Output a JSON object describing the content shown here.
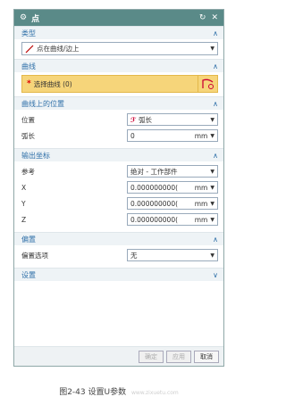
{
  "dialog": {
    "title": "点",
    "reset_icon": "reset-icon",
    "close_icon": "close-icon"
  },
  "type_section": {
    "header": "类型",
    "value": "点在曲线/边上"
  },
  "curve_section": {
    "header": "曲线",
    "select_label": "选择曲线 (0)"
  },
  "position_section": {
    "header": "曲线上的位置",
    "position_label": "位置",
    "position_value": "弧长",
    "arc_label": "弧长",
    "arc_value": "0",
    "arc_unit": "mm"
  },
  "output_section": {
    "header": "输出坐标",
    "ref_label": "参考",
    "ref_value": "绝对 - 工作部件",
    "x_label": "X",
    "x_value": "0.000000000(",
    "x_unit": "mm",
    "y_label": "Y",
    "y_value": "0.000000000(",
    "y_unit": "mm",
    "z_label": "Z",
    "z_value": "0.000000000(",
    "z_unit": "mm"
  },
  "offset_section": {
    "header": "偏置",
    "option_label": "偏置选项",
    "option_value": "无"
  },
  "settings_section": {
    "header": "设置"
  },
  "footer": {
    "ok": "确定",
    "apply": "应用",
    "cancel": "取消"
  },
  "caption": {
    "text": "图2-43 设置U参数",
    "watermark": "www.zixuetu.com"
  }
}
